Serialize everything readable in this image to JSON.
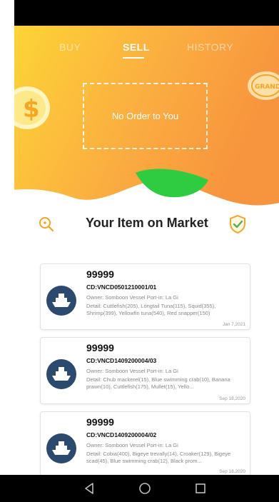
{
  "tabs": {
    "buy": "BUY",
    "sell": "SELL",
    "history": "HISTORY"
  },
  "order_box": {
    "empty_text": "No Order to You"
  },
  "coin_right_label": "GRAND",
  "section": {
    "title": "Your Item on Market"
  },
  "items": [
    {
      "name": "99999",
      "code": "CD:VNCD0501210001/01",
      "owner": "Owner: Somboon Vessel  Port-in: La Gi",
      "detail": "Detail: Cuttlefish(205), Longtail Tuna(115), Squid(355), Shrimp(399), Yellowfin tuna(540), Red snapper(150)",
      "date": "Jan 7,2021"
    },
    {
      "name": "99999",
      "code": "CD:VNCD1409200004/03",
      "owner": "Owner: Somboon Vessel  Port-in: La Gi",
      "detail": "Detail: Chub mackerel(15), Blue swimming crab(10), Banana prawn(10), Cuttlefish(175), Mullet(15), Yello...",
      "date": "Sep 18,2020"
    },
    {
      "name": "99999",
      "code": "CD:VNCD1409200004/02",
      "owner": "Owner: Somboon Vessel  Port-in: La Gi",
      "detail": "Detail: Cobia(400), Bigeye trevally(14), Croaker(129), Bigeye scad(45), Blue swimming crab(12), Black prom...",
      "date": "Sep 18,2020"
    }
  ],
  "colors": {
    "accent": "#f5a623",
    "gradient_start": "#fdd835",
    "gradient_end": "#f79a3e",
    "wave_green": "#2ecc40",
    "avatar_bg": "#2c4a6e",
    "shield": "#4caf50"
  },
  "icons": {
    "search": "search-icon",
    "shield": "shield-check-icon",
    "ship": "ship-icon",
    "dollar": "dollar-coin-icon",
    "back": "back-icon",
    "home": "home-icon",
    "recents": "recents-icon"
  }
}
